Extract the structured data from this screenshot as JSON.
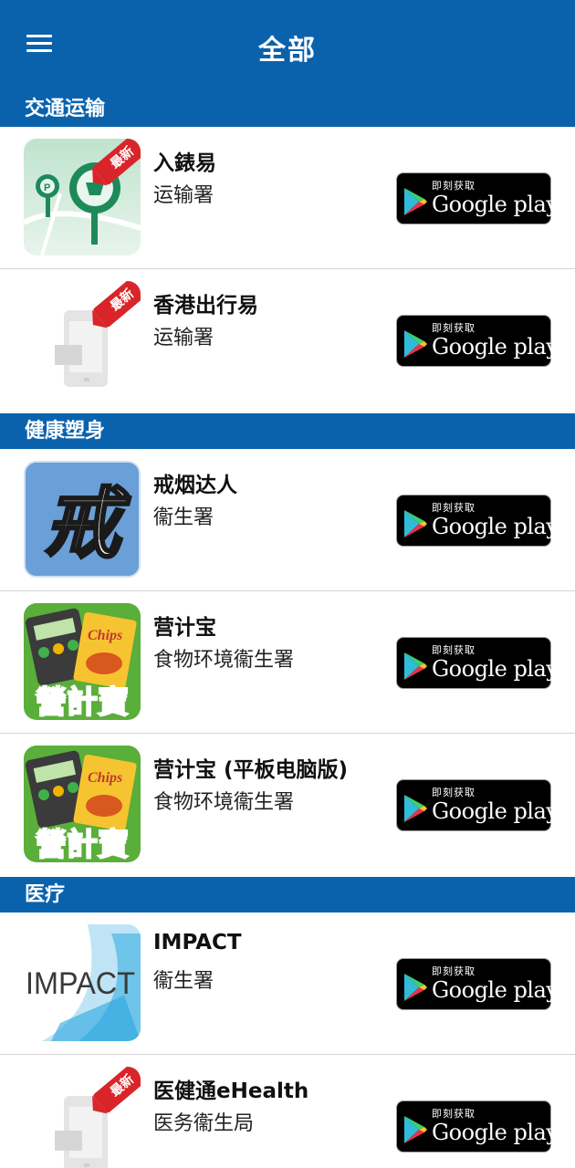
{
  "header": {
    "title": "全部"
  },
  "badge_text": "最新",
  "store_badge": {
    "sub": "即刻获取",
    "brand": "Google play"
  },
  "sections": [
    {
      "title": "交通运输",
      "apps": [
        {
          "name": "入錶易",
          "developer": "运输署",
          "icon": "parking-meter-icon"
        },
        {
          "name": "香港出行易",
          "developer": "运输署",
          "icon": "placeholder-device-icon"
        }
      ]
    },
    {
      "title": "健康塑身",
      "apps": [
        {
          "name": "戒烟达人",
          "developer": "衞生署",
          "icon": "quit-smoking-icon",
          "icon_text": "戒"
        },
        {
          "name": "营计宝",
          "developer": "食物环境衞生署",
          "icon": "nutrition-calculator-icon",
          "icon_text": "營計寶",
          "icon_sub": "Chips"
        },
        {
          "name": "营计宝 (平板电脑版)",
          "developer": "食物环境衞生署",
          "icon": "nutrition-calculator-icon",
          "icon_text": "營計寶",
          "icon_sub": "Chips"
        }
      ]
    },
    {
      "title": "医疗",
      "apps": [
        {
          "name": "IMPACT",
          "developer": "衞生署",
          "icon": "impact-logo-icon",
          "icon_text": "IMPACT"
        },
        {
          "name": "医健通eHealth",
          "developer": "医务衞生局",
          "icon": "placeholder-device-icon"
        }
      ]
    }
  ],
  "colors": {
    "primary": "#0a62ad",
    "badge_red": "#d9252a"
  }
}
